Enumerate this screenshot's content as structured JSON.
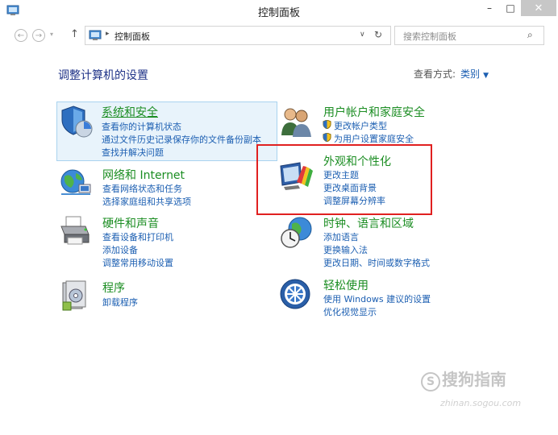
{
  "window": {
    "title": "控制面板",
    "minimize": "–",
    "maximize": "□",
    "close": "✕"
  },
  "nav": {
    "back": "←",
    "forward": "→",
    "history_dropdown": "▾",
    "up": "↑",
    "breadcrumb_sep": "▸",
    "breadcrumb": "控制面板",
    "address_dropdown": "∨",
    "refresh": "↻",
    "search_placeholder": "搜索控制面板",
    "search_icon": "⌕"
  },
  "content": {
    "heading": "调整计算机的设置",
    "view_by_label": "查看方式:",
    "view_by_value": "类别",
    "view_by_caret": "▼"
  },
  "categories": {
    "system": {
      "title": "系统和安全",
      "links": [
        "查看你的计算机状态",
        "通过文件历史记录保存你的文件备份副本",
        "查找并解决问题"
      ]
    },
    "network": {
      "title": "网络和 Internet",
      "links": [
        "查看网络状态和任务",
        "选择家庭组和共享选项"
      ]
    },
    "hardware": {
      "title": "硬件和声音",
      "links": [
        "查看设备和打印机",
        "添加设备",
        "调整常用移动设置"
      ]
    },
    "programs": {
      "title": "程序",
      "links": [
        "卸载程序"
      ]
    },
    "users": {
      "title": "用户帐户和家庭安全",
      "links": [
        "更改帐户类型",
        "为用户设置家庭安全"
      ]
    },
    "appearance": {
      "title": "外观和个性化",
      "links": [
        "更改主题",
        "更改桌面背景",
        "调整屏幕分辨率"
      ]
    },
    "clock": {
      "title": "时钟、语言和区域",
      "links": [
        "添加语言",
        "更换输入法",
        "更改日期、时间或数字格式"
      ]
    },
    "ease": {
      "title": "轻松使用",
      "links": [
        "使用 Windows 建议的设置",
        "优化视觉显示"
      ]
    }
  },
  "watermark": {
    "glyph": "S",
    "text": "搜狗指南",
    "url": "zhinan.sogou.com"
  },
  "icons": {
    "app": "control-panel-icon",
    "system": "shield-icon",
    "network": "globe-network-icon",
    "hardware": "printer-icon",
    "programs": "programs-icon",
    "users": "users-icon",
    "appearance": "monitor-color-icon",
    "clock": "clock-globe-icon",
    "ease": "ease-of-access-icon"
  },
  "colors": {
    "category_title": "#1b8d22",
    "link": "#1c5fb2",
    "heading": "#1e3287",
    "highlight_border": "#e02020"
  }
}
